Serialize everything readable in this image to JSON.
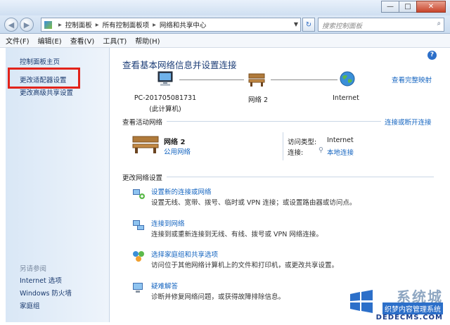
{
  "window": {
    "minimize": "—",
    "maximize": "□",
    "close": "✕"
  },
  "nav": {
    "breadcrumb": [
      "控制面板",
      "所有控制面板项",
      "网络和共享中心"
    ],
    "search_placeholder": "搜索控制面板"
  },
  "menu": [
    "文件(F)",
    "编辑(E)",
    "查看(V)",
    "工具(T)",
    "帮助(H)"
  ],
  "sidebar": {
    "home": "控制面板主页",
    "change_adapter": "更改适配器设置",
    "change_sharing": "更改高级共享设置",
    "see_also_title": "另请参阅",
    "see_also": [
      "Internet 选项",
      "Windows 防火墙",
      "家庭组"
    ]
  },
  "main": {
    "title": "查看基本网络信息并设置连接",
    "full_map": "查看完整映射",
    "map": {
      "computer": "PC-201705081731",
      "computer_sub": "(此计算机)",
      "network": "网络  2",
      "internet": "Internet"
    },
    "active_title": "查看活动网络",
    "connect_disconnect": "连接或断开连接",
    "active": {
      "name": "网络  2",
      "type": "公用网络",
      "access_label": "访问类型:",
      "access_value": "Internet",
      "conn_label": "连接:",
      "conn_value": "本地连接"
    },
    "settings_title": "更改网络设置",
    "tasks": [
      {
        "link": "设置新的连接或网络",
        "desc": "设置无线、宽带、拨号、临时或 VPN 连接；或设置路由器或访问点。"
      },
      {
        "link": "连接到网络",
        "desc": "连接到或重新连接到无线、有线、拨号或 VPN 网络连接。"
      },
      {
        "link": "选择家庭组和共享选项",
        "desc": "访问位于其他网络计算机上的文件和打印机，或更改共享设置。"
      },
      {
        "link": "疑难解答",
        "desc": "诊断并修复网络问题，或获得故障排除信息。"
      }
    ]
  },
  "watermark": {
    "brand": "系统城",
    "tagline": "织梦内容管理系统",
    "site": "DEDECMS.COM"
  }
}
